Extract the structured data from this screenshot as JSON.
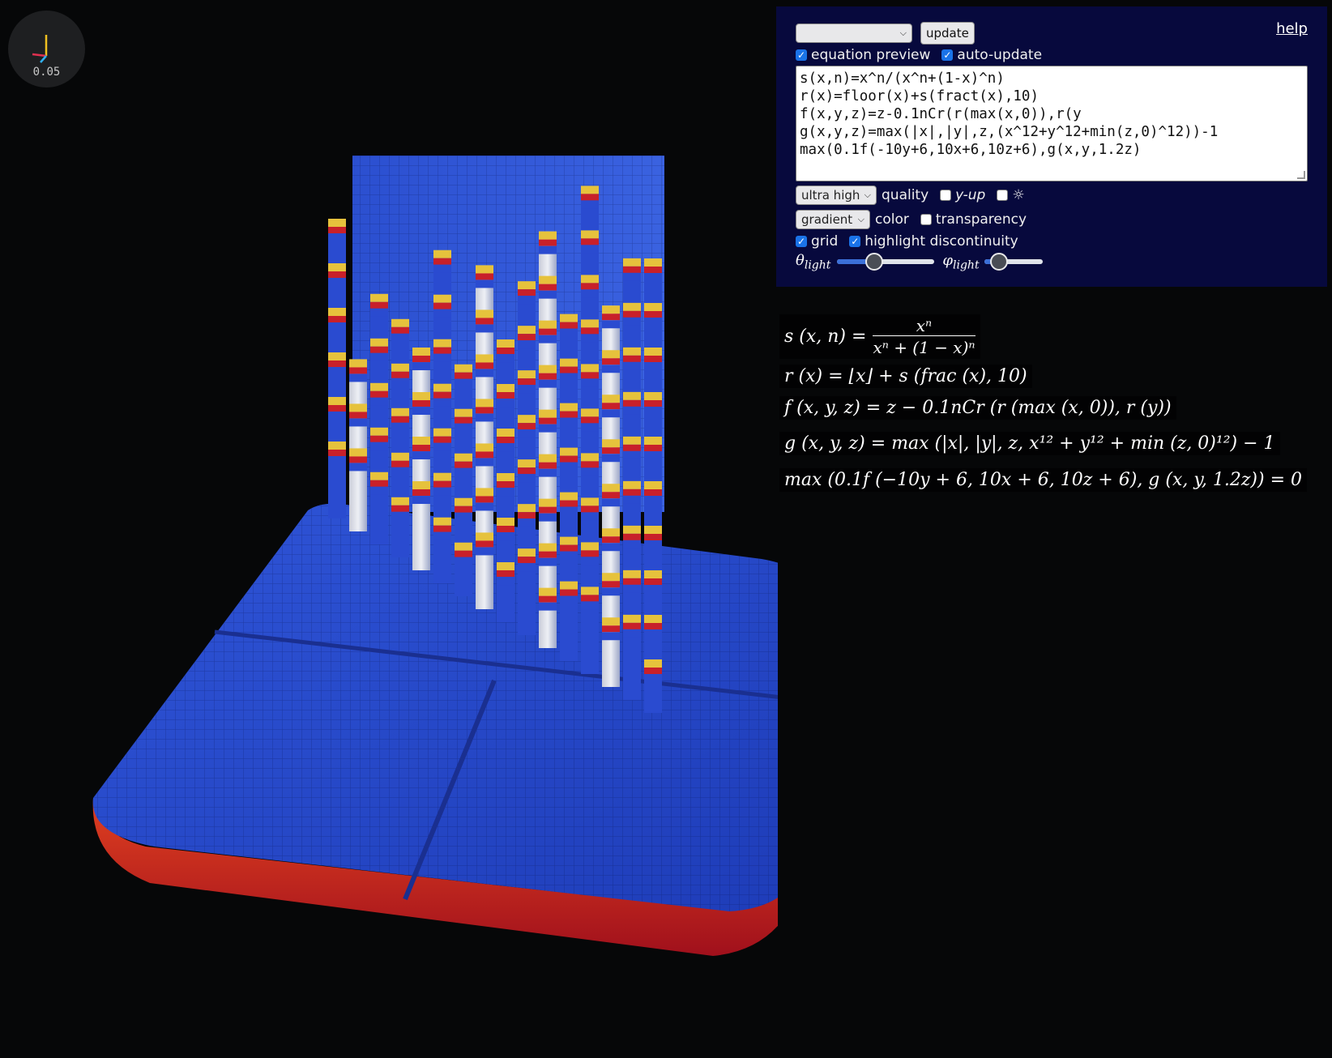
{
  "axis_indicator": {
    "scale": "0.05",
    "icon": "axis-gizmo-icon"
  },
  "panel": {
    "preset_select": {
      "value": ""
    },
    "update_button": "update",
    "help_link": "help",
    "equation_preview": {
      "label": "equation preview",
      "checked": true
    },
    "auto_update": {
      "label": "auto-update",
      "checked": true
    },
    "equation_text": "s(x,n)=x^n/(x^n+(1-x)^n)\nr(x)=floor(x)+s(fract(x),10)\nf(x,y,z)=z-0.1nCr(r(max(x,0)),r(y\ng(x,y,z)=max(|x|,|y|,z,(x^12+y^12+min(z,0)^12))-1\nmax(0.1f(-10y+6,10x+6,10z+6),g(x,y,1.2z)",
    "quality": {
      "value": "ultra high",
      "label": "quality"
    },
    "y_up": {
      "label": "y-up",
      "checked": false
    },
    "light_toggle": {
      "label": "☼",
      "checked": false
    },
    "color": {
      "value": "gradient",
      "label": "color"
    },
    "transparency": {
      "label": "transparency",
      "checked": false
    },
    "grid": {
      "label": "grid",
      "checked": true
    },
    "highlight_discontinuity": {
      "label": "highlight discontinuity",
      "checked": true
    },
    "theta_light": {
      "symbol": "θ",
      "sub": "light",
      "value": 0.35
    },
    "phi_light": {
      "symbol": "φ",
      "sub": "light",
      "value": 0.15
    }
  },
  "preview": {
    "s": {
      "lhs": "s (x, n) =",
      "num": "xⁿ",
      "den": "xⁿ + (1 − x)ⁿ"
    },
    "r": "r (x) = ⌊x⌋ + s (frac (x), 10)",
    "f": "f (x, y, z) = z − 0.1nCr (r (max (x, 0)), r (y))",
    "g": "g (x, y, z) = max (|x|, |y|, z, x¹² + y¹² + min (z, 0)¹²) − 1",
    "main": "max (0.1f (−10y + 6, 10x + 6, 10z + 6), g (x, y, 1.2z)) = 0"
  },
  "colors": {
    "surface_blue": "#2a4bd0",
    "surface_red": "#c8202a",
    "surface_yellow": "#e6c23c",
    "surface_white": "#d8dbe2",
    "panel_bg": "#07093d"
  }
}
